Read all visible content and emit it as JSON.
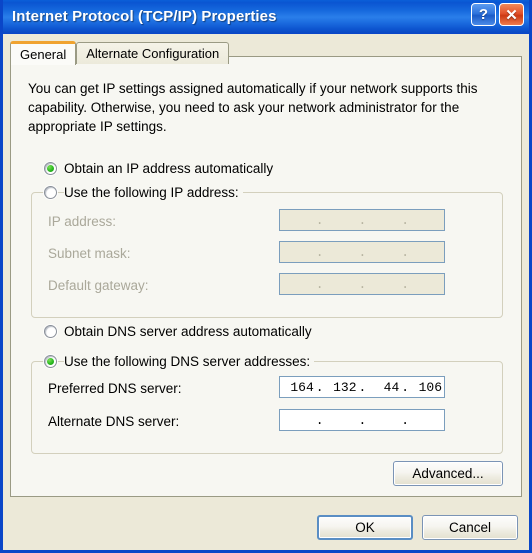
{
  "window": {
    "title": "Internet Protocol (TCP/IP) Properties",
    "help_button": "?",
    "close_button": "✕",
    "accent_color": "#0a46c8",
    "face_color": "#ece9d8",
    "page_color": "#f7f7f2",
    "active_tab_marker_color": "#f0a330",
    "radio_dot_color": "#2aba22"
  },
  "tabs": [
    {
      "label": "General",
      "active": true
    },
    {
      "label": "Alternate Configuration",
      "active": false
    }
  ],
  "general": {
    "intro": "You can get IP settings assigned automatically if your network supports this capability. Otherwise, you need to ask your network administrator for the appropriate IP settings.",
    "ip_mode": {
      "automatic": {
        "label": "Obtain an IP address automatically",
        "checked": true
      },
      "manual": {
        "label": "Use the following IP address:",
        "checked": false
      }
    },
    "ip_fields": [
      {
        "label": "IP address:",
        "disabled": true,
        "octets": [
          "",
          "",
          "",
          ""
        ]
      },
      {
        "label": "Subnet mask:",
        "disabled": true,
        "octets": [
          "",
          "",
          "",
          ""
        ]
      },
      {
        "label": "Default gateway:",
        "disabled": true,
        "octets": [
          "",
          "",
          "",
          ""
        ]
      }
    ],
    "dns_mode": {
      "automatic": {
        "label": "Obtain DNS server address automatically",
        "checked": false
      },
      "manual": {
        "label": "Use the following DNS server addresses:",
        "checked": true
      }
    },
    "dns_fields": [
      {
        "label": "Preferred DNS server:",
        "disabled": false,
        "value": "164.132.44.106",
        "octets": [
          "164",
          "132",
          "44",
          "106"
        ]
      },
      {
        "label": "Alternate DNS server:",
        "disabled": false,
        "value": "",
        "octets": [
          "",
          "",
          "",
          ""
        ]
      }
    ],
    "advanced_button": "Advanced..."
  },
  "footer": {
    "ok_button": "OK",
    "cancel_button": "Cancel"
  },
  "separator": "."
}
